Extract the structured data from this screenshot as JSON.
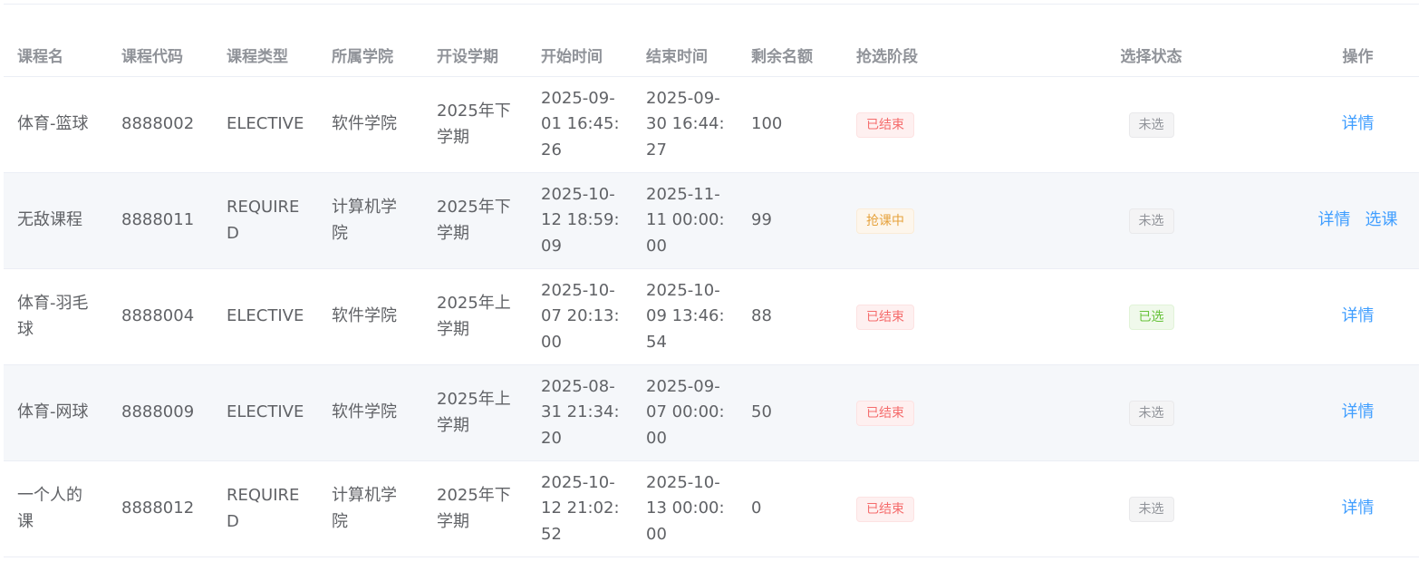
{
  "columns": {
    "name": "课程名",
    "code": "课程代码",
    "type": "课程类型",
    "college": "所属学院",
    "term": "开设学期",
    "start": "开始时间",
    "end": "结束时间",
    "remaining": "剩余名额",
    "stage": "抢选阶段",
    "status": "选择状态",
    "actions": "操作"
  },
  "rows": [
    {
      "name": "体育-篮球",
      "code": "8888002",
      "type": "ELECTIVE",
      "college": "软件学院",
      "term": "2025年下学期",
      "start": "2025-09-01 16:45:26",
      "end": "2025-09-30 16:44:27",
      "remaining": "100",
      "stage": "已结束",
      "status": "未选",
      "detail_label": "详情"
    },
    {
      "name": "无敌课程",
      "code": "8888011",
      "type": "REQUIRED",
      "college": "计算机学院",
      "term": "2025年下学期",
      "start": "2025-10-12 18:59:09",
      "end": "2025-11-11 00:00:00",
      "remaining": "99",
      "stage": "抢课中",
      "status": "未选",
      "detail_label": "详情",
      "select_label": "选课"
    },
    {
      "name": "体育-羽毛球",
      "code": "8888004",
      "type": "ELECTIVE",
      "college": "软件学院",
      "term": "2025年上学期",
      "start": "2025-10-07 20:13:00",
      "end": "2025-10-09 13:46:54",
      "remaining": "88",
      "stage": "已结束",
      "status": "已选",
      "detail_label": "详情"
    },
    {
      "name": "体育-网球",
      "code": "8888009",
      "type": "ELECTIVE",
      "college": "软件学院",
      "term": "2025年上学期",
      "start": "2025-08-31 21:34:20",
      "end": "2025-09-07 00:00:00",
      "remaining": "50",
      "stage": "已结束",
      "status": "未选",
      "detail_label": "详情"
    },
    {
      "name": "一个人的课",
      "code": "8888012",
      "type": "REQUIRED",
      "college": "计算机学院",
      "term": "2025年下学期",
      "start": "2025-10-12 21:02:52",
      "end": "2025-10-13 00:00:00",
      "remaining": "0",
      "stage": "已结束",
      "status": "未选",
      "detail_label": "详情"
    }
  ],
  "colors": {
    "link": "#409eff",
    "stage_ended": "#f56c6c",
    "stage_ongoing": "#e6a23c",
    "status_selected": "#67c23a",
    "status_unselected": "#909399"
  }
}
